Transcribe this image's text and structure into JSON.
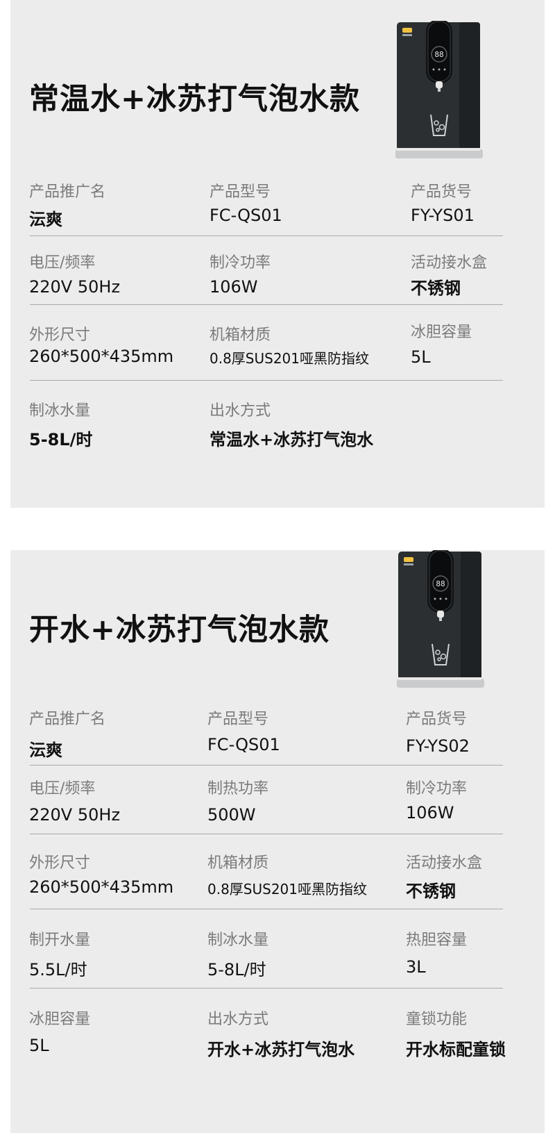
{
  "cards": [
    {
      "title": "常温水+冰苏打气泡水款",
      "fields": [
        {
          "label": "产品推广名",
          "value": "沄爽"
        },
        {
          "label": "产品型号",
          "value": "FC-QS01"
        },
        {
          "label": "产品货号",
          "value": "FY-YS01"
        },
        {
          "label": "电压/频率",
          "value": "220V 50Hz"
        },
        {
          "label": "制冷功率",
          "value": "106W"
        },
        {
          "label": "活动接水盒",
          "value": "不锈钢"
        },
        {
          "label": "外形尺寸",
          "value": "260*500*435mm"
        },
        {
          "label": "机箱材质",
          "value": "0.8厚SUS201哑黑防指纹"
        },
        {
          "label": "冰胆容量",
          "value": "5L"
        },
        {
          "label": "制冰水量",
          "value": "5-8L/时"
        },
        {
          "label": "出水方式",
          "value": "常温水+冰苏打气泡水"
        }
      ]
    },
    {
      "title": "开水+冰苏打气泡水款",
      "fields": [
        {
          "label": "产品推广名",
          "value": "沄爽"
        },
        {
          "label": "产品型号",
          "value": "FC-QS01"
        },
        {
          "label": "产品货号",
          "value": "FY-YS02"
        },
        {
          "label": "电压/频率",
          "value": "220V 50Hz"
        },
        {
          "label": "制热功率",
          "value": "500W"
        },
        {
          "label": "制冷功率",
          "value": "106W"
        },
        {
          "label": "外形尺寸",
          "value": "260*500*435mm"
        },
        {
          "label": "机箱材质",
          "value": "0.8厚SUS201哑黑防指纹"
        },
        {
          "label": "活动接水盒",
          "value": "不锈钢"
        },
        {
          "label": "制开水量",
          "value": "5.5L/时"
        },
        {
          "label": "制冰水量",
          "value": "5-8L/时"
        },
        {
          "label": "热胆容量",
          "value": "3L"
        },
        {
          "label": "冰胆容量",
          "value": "5L"
        },
        {
          "label": "出水方式",
          "value": "开水+冰苏打气泡水"
        },
        {
          "label": "童锁功能",
          "value": "开水标配童锁"
        }
      ]
    }
  ],
  "device": {
    "display_digits": "88",
    "logo_text": "沄爽"
  },
  "colors": {
    "card_bg": "#ececec",
    "device_body": "#2b2f31",
    "label_gray": "#7b7b7b"
  }
}
